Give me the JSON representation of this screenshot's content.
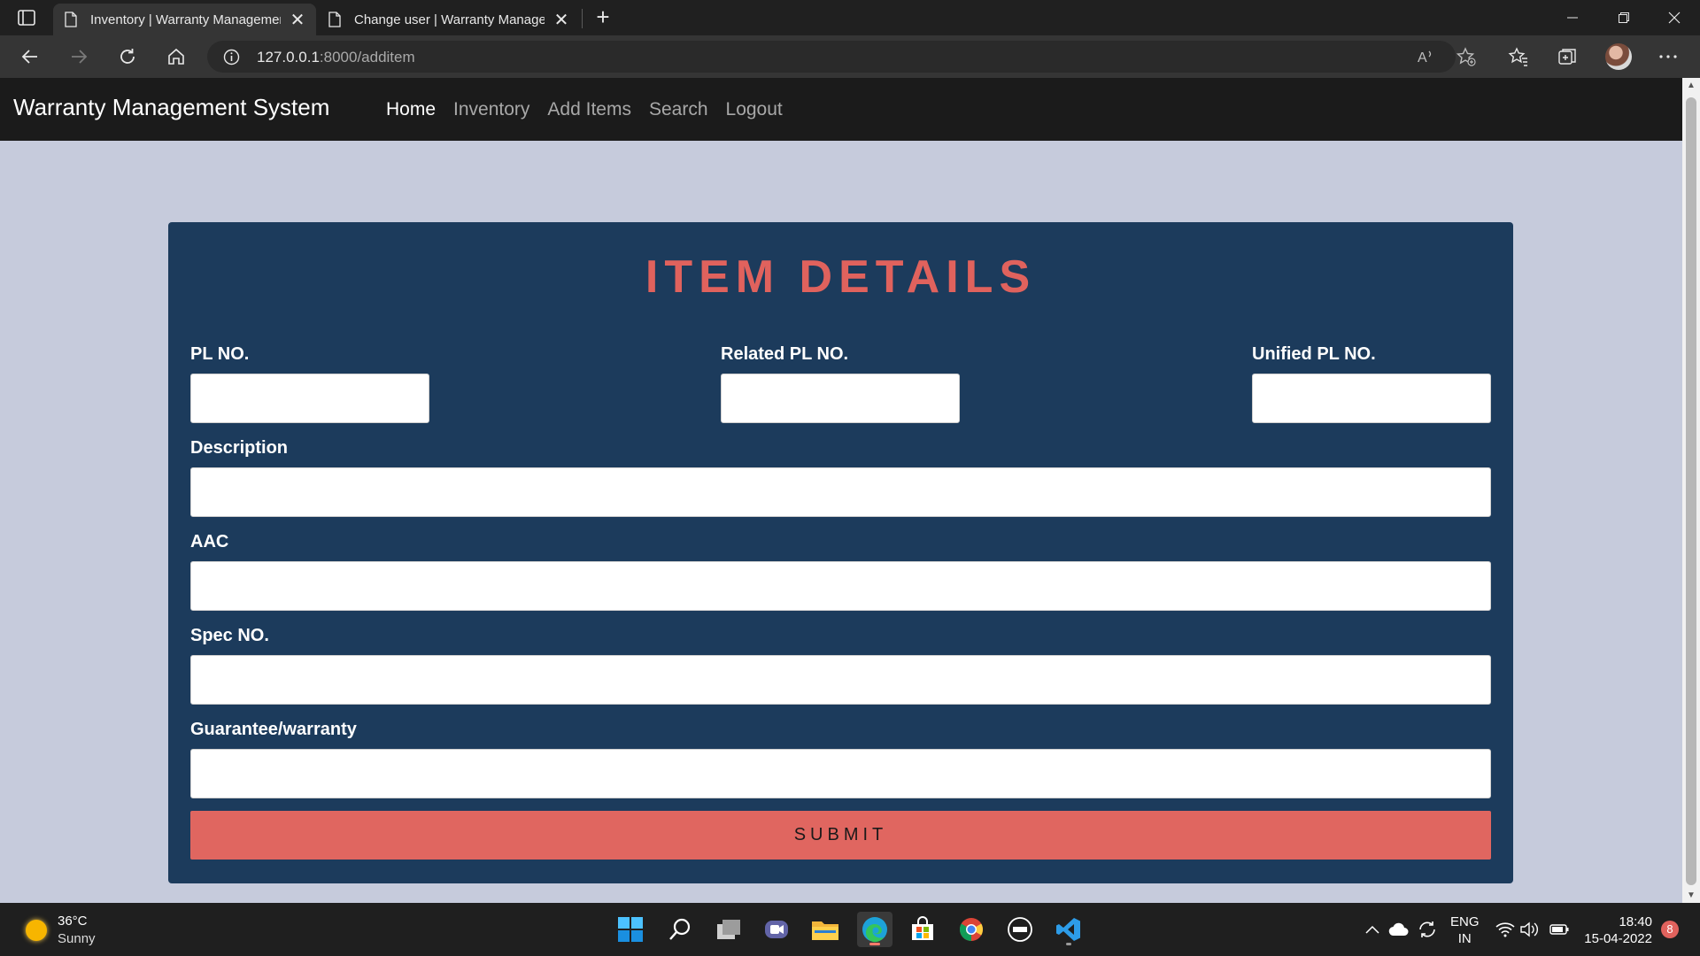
{
  "browser": {
    "tabs": [
      {
        "title": "Inventory | Warranty Management",
        "close": "✕",
        "active": true
      },
      {
        "title": "Change user | Warranty Management",
        "close": "✕",
        "active": false
      }
    ],
    "new_tab": "+",
    "url_host": "127.0.0.1",
    "url_path": ":8000/additem"
  },
  "site": {
    "brand": "Warranty Management System",
    "nav": [
      "Home",
      "Inventory",
      "Add Items",
      "Search",
      "Logout"
    ],
    "active_nav": "Home"
  },
  "form": {
    "title": "ITEM DETAILS",
    "fields": [
      {
        "label": "PL NO.",
        "value": ""
      },
      {
        "label": "Related PL NO.",
        "value": ""
      },
      {
        "label": "Unified PL NO.",
        "value": ""
      },
      {
        "label": "Description",
        "value": ""
      },
      {
        "label": "AAC",
        "value": ""
      },
      {
        "label": "Spec NO.",
        "value": ""
      },
      {
        "label": "Guarantee/warranty",
        "value": ""
      }
    ],
    "submit_label": "SUBMIT"
  },
  "taskbar": {
    "weather_temp": "36°C",
    "weather_desc": "Sunny",
    "lang_line1": "ENG",
    "lang_line2": "IN",
    "time": "18:40",
    "date": "15-04-2022",
    "notification_count": "8"
  },
  "colors": {
    "nav_bg": "#1b1b1b",
    "page_bg": "#c6cbdc",
    "card_bg": "#1c3b5c",
    "accent": "#e0625d"
  }
}
